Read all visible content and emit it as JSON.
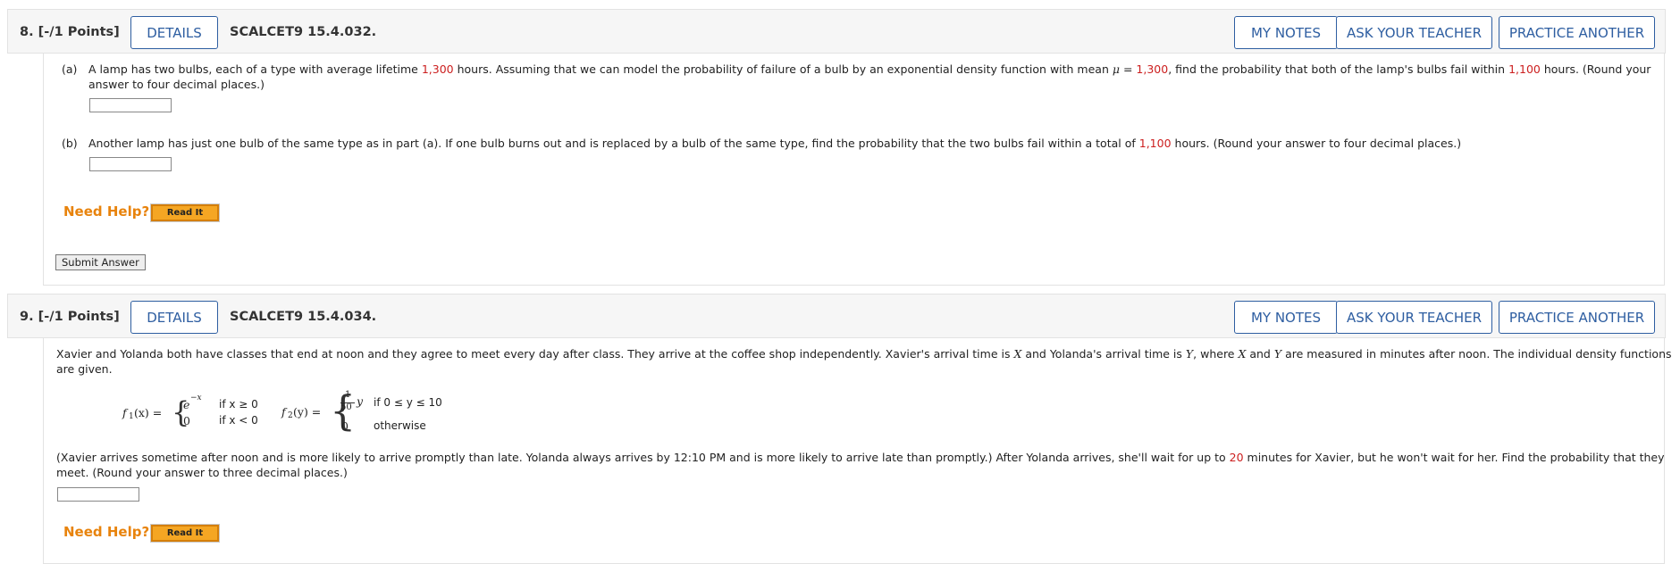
{
  "q8": {
    "number": "8.  [-/1 Points]",
    "details": "DETAILS",
    "id": "SCALCET9 15.4.032.",
    "my_notes": "MY NOTES",
    "ask_teacher": "ASK YOUR TEACHER",
    "practice": "PRACTICE ANOTHER",
    "part_a_label": "(a)",
    "part_a_t1": "A lamp has two bulbs, each of a type with average lifetime ",
    "part_a_v1": "1,300",
    "part_a_t2": " hours. Assuming that we can model the probability of failure of a bulb by an exponential density function with mean ",
    "part_a_mu": "μ",
    "part_a_eq": " = ",
    "part_a_v2": "1,300",
    "part_a_t3": ", find the probability that both of the lamp's bulbs fail within ",
    "part_a_v3": "1,100",
    "part_a_t4": " hours. (Round your",
    "part_a_line2": "answer to four decimal places.)",
    "part_b_label": "(b)",
    "part_b_t1": "Another lamp has just one bulb of the same type as in part (a). If one bulb burns out and is replaced by a bulb of the same type, find the probability that the two bulbs fail within a total of ",
    "part_b_v1": "1,100",
    "part_b_t2": " hours. (Round your answer to four decimal places.)",
    "need_help": "Need Help?",
    "read_it": "Read It",
    "submit": "Submit Answer"
  },
  "q9": {
    "number": "9.  [-/1 Points]",
    "details": "DETAILS",
    "id": "SCALCET9 15.4.034.",
    "my_notes": "MY NOTES",
    "ask_teacher": "ASK YOUR TEACHER",
    "practice": "PRACTICE ANOTHER",
    "intro_t1": "Xavier and Yolanda both have classes that end at noon and they agree to meet every day after class. They arrive at the coffee shop independently. Xavier's arrival time is ",
    "intro_x": "X",
    "intro_t2": " and Yolanda's arrival time is ",
    "intro_y": "Y",
    "intro_t3": ", where ",
    "intro_x2": "X",
    "intro_t4": " and ",
    "intro_y2": "Y",
    "intro_t5": " are measured in minutes after noon. The individual density functions",
    "intro_line2": "are given.",
    "f1_name": "f",
    "f1_sub": "1",
    "f1_arg": "(x) =",
    "f1_case1_expr": "e",
    "f1_case1_sup": "−x",
    "f1_case1_cond": "if x ≥ 0",
    "f1_case2_expr": "0",
    "f1_case2_cond": "if x < 0",
    "f2_name": "f",
    "f2_sub": "2",
    "f2_arg": "(y) =",
    "f2_frac_num": "1",
    "f2_frac_den": "50",
    "f2_case1_var": "y",
    "f2_case1_cond": "if 0 ≤ y ≤ 10",
    "f2_case2_expr": "0",
    "f2_case2_cond": "otherwise",
    "para_t1": "(Xavier arrives sometime after noon and is more likely to arrive promptly than late. Yolanda always arrives by 12:10 PM and is more likely to arrive late than promptly.) After Yolanda arrives, she'll wait for up to ",
    "para_v1": "20",
    "para_t2": " minutes for Xavier, but he won't wait for her. Find the probability that they",
    "para_line2": "meet. (Round your answer to three decimal places.)",
    "need_help": "Need Help?",
    "read_it": "Read It"
  }
}
